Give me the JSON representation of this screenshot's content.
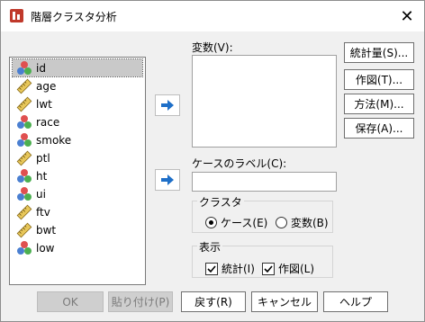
{
  "window": {
    "title": "階層クラスタ分析",
    "close_glyph": "✕"
  },
  "variables": [
    {
      "name": "id",
      "type": "nominal",
      "selected": true
    },
    {
      "name": "age",
      "type": "scale"
    },
    {
      "name": "lwt",
      "type": "scale"
    },
    {
      "name": "race",
      "type": "nominal"
    },
    {
      "name": "smoke",
      "type": "nominal"
    },
    {
      "name": "ptl",
      "type": "scale"
    },
    {
      "name": "ht",
      "type": "nominal"
    },
    {
      "name": "ui",
      "type": "nominal"
    },
    {
      "name": "ftv",
      "type": "scale"
    },
    {
      "name": "bwt",
      "type": "scale"
    },
    {
      "name": "low",
      "type": "nominal"
    }
  ],
  "fields": {
    "variables_label": "変数(V):",
    "case_label_label": "ケースのラベル(C):"
  },
  "side_buttons": {
    "statistics": "統計量(S)...",
    "plots": "作図(T)...",
    "method": "方法(M)...",
    "save": "保存(A)..."
  },
  "cluster_group": {
    "title": "クラスタ",
    "option_cases": "ケース(E)",
    "option_variables": "変数(B)",
    "selected": "cases"
  },
  "display_group": {
    "title": "表示",
    "statistics": "統計(I)",
    "plots": "作図(L)",
    "statistics_checked": true,
    "plots_checked": true
  },
  "bottom_buttons": {
    "ok": "OK",
    "paste": "貼り付け(P)",
    "reset": "戻す(R)",
    "cancel": "キャンセル",
    "help": "ヘルプ"
  },
  "colors": {
    "arrow_blue": "#1e6fc8",
    "nominal_red": "#e05050",
    "nominal_blue": "#4a7fd1",
    "nominal_green": "#4caf50",
    "ruler_yellow": "#e8c75a"
  }
}
